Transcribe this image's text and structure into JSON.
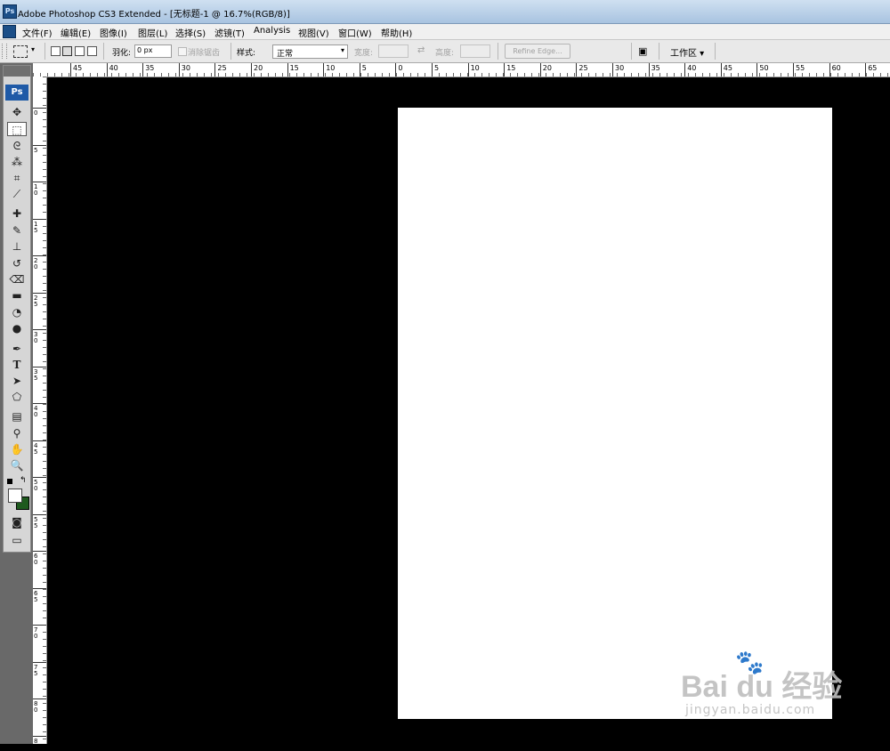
{
  "window": {
    "app_icon": "Ps",
    "title": "Adobe Photoshop CS3 Extended - [无标题-1 @ 16.7%(RGB/8)]"
  },
  "menubar": {
    "items": [
      "文件(F)",
      "编辑(E)",
      "图像(I)",
      "图层(L)",
      "选择(S)",
      "滤镜(T)",
      "Analysis",
      "视图(V)",
      "窗口(W)",
      "帮助(H)"
    ]
  },
  "options_bar": {
    "feather_label": "羽化:",
    "feather_value": "0 px",
    "antialias_label": "消除锯齿",
    "style_label": "样式:",
    "style_value": "正常",
    "width_label": "宽度:",
    "height_label": "高度:",
    "refine_edge_label": "Refine Edge...",
    "workspace_label": "工作区 ▾"
  },
  "toolbox": {
    "logo": "Ps",
    "tools": [
      "move-tool",
      "marquee-tool",
      "lasso-tool",
      "magic-wand-tool",
      "crop-tool",
      "slice-tool",
      "healing-brush-tool",
      "brush-tool",
      "clone-stamp-tool",
      "history-brush-tool",
      "eraser-tool",
      "gradient-tool",
      "blur-tool",
      "dodge-tool",
      "pen-tool",
      "type-tool",
      "path-selection-tool",
      "shape-tool",
      "notes-tool",
      "eyedropper-tool",
      "hand-tool",
      "zoom-tool"
    ],
    "foreground_color": "#ffffff",
    "background_color": "#1e5a1e"
  },
  "rulers": {
    "horizontal_labels": [
      "45",
      "40",
      "35",
      "30",
      "25",
      "20",
      "15",
      "10",
      "5",
      "0",
      "5",
      "10",
      "15",
      "20",
      "25",
      "30",
      "35",
      "40",
      "45",
      "50",
      "55",
      "60",
      "65"
    ],
    "vertical_labels": [
      "0",
      "5",
      "10",
      "15",
      "20",
      "25",
      "30",
      "35",
      "40",
      "45",
      "50",
      "55",
      "60",
      "65",
      "70",
      "75",
      "80",
      "85"
    ]
  },
  "document": {
    "canvas_color": "#ffffff",
    "pasteboard_color": "#000000"
  },
  "watermark": {
    "brand": "Bai du 经验",
    "url": "jingyan.baidu.com"
  }
}
